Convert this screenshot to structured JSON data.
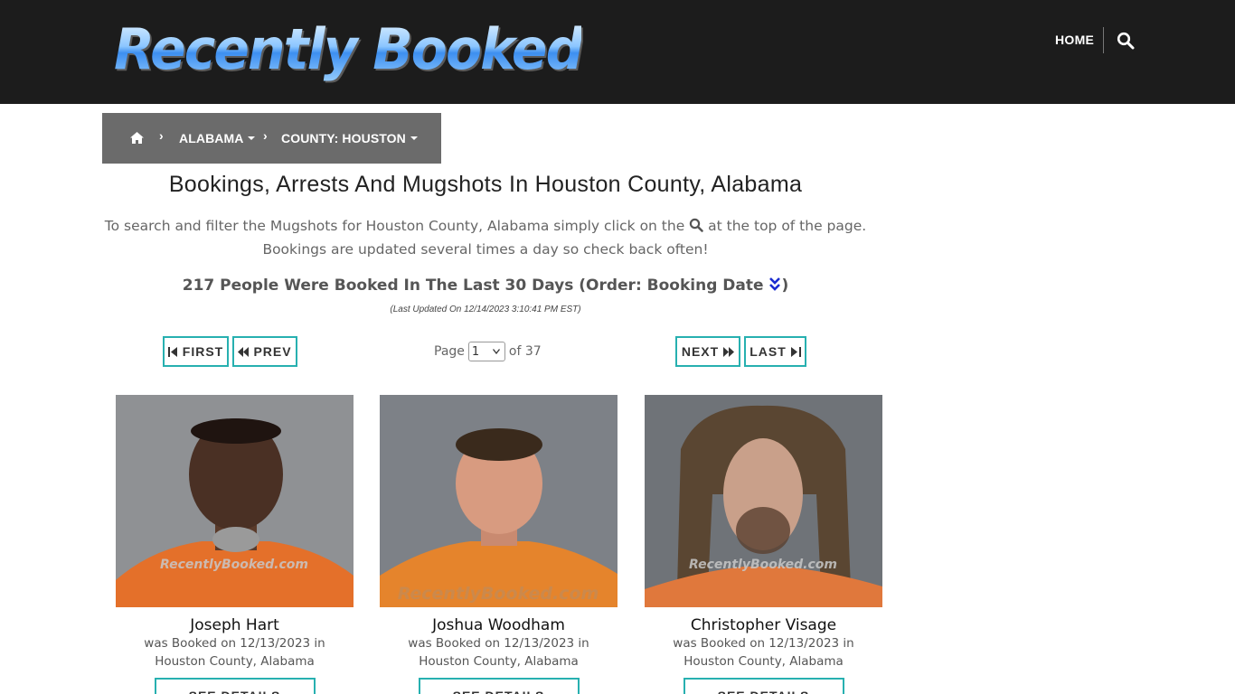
{
  "header": {
    "logo_text": "Recently Booked",
    "nav_home": "HOME",
    "search_icon": "search-icon"
  },
  "breadcrumb": {
    "home_icon": "home-icon",
    "items": [
      {
        "label": "ALABAMA"
      },
      {
        "label": "COUNTY: HOUSTON"
      }
    ]
  },
  "page": {
    "title": "Bookings, Arrests And Mugshots In Houston County, Alabama",
    "intro_before": "To search and filter the Mugshots for Houston County, Alabama simply click on the",
    "intro_after": "at the top of the page.",
    "intro_line2": "Bookings are updated several times a day so check back often!",
    "count_text": "217 People Were Booked In The Last 30 Days (Order: Booking Date",
    "count_close": ")",
    "updated": "(Last Updated On 12/14/2023 3:10:41 PM EST)"
  },
  "pagination": {
    "first": "FIRST",
    "prev": "PREV",
    "next": "NEXT",
    "last": "LAST",
    "page_label": "Page",
    "current_page": "1",
    "of_label": "of 37"
  },
  "cards": [
    {
      "name": "Joseph Hart",
      "line1": "was Booked on 12/13/2023 in",
      "line2": "Houston County, Alabama",
      "button": "SEE DETAILS",
      "watermark": "RecentlyBooked.com"
    },
    {
      "name": "Joshua Woodham",
      "line1": "was Booked on 12/13/2023 in",
      "line2": "Houston County, Alabama",
      "button": "SEE DETAILS",
      "watermark": "RecentlyBooked.com"
    },
    {
      "name": "Christopher Visage",
      "line1": "was Booked on 12/13/2023 in",
      "line2": "Houston County, Alabama",
      "button": "SEE DETAILS",
      "watermark": "RecentlyBooked.com"
    }
  ],
  "colors": {
    "header_bg": "#1c1c1c",
    "breadcrumb_bg": "#6b6b6b",
    "accent": "#27b0b0",
    "sort_icon": "#1a2bd0"
  }
}
